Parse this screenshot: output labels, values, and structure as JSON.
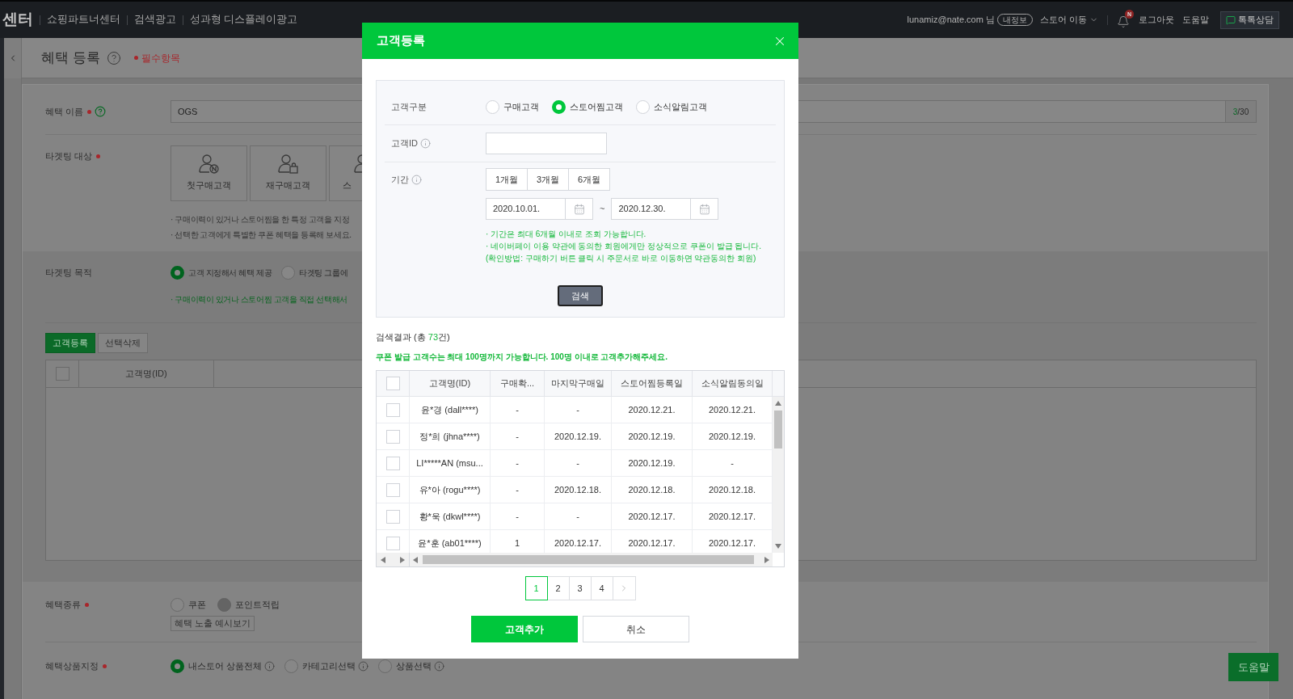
{
  "top_bar": {
    "logo": "센터",
    "menu": [
      "쇼핑파트너센터",
      "검색광고",
      "성과형 디스플레이광고"
    ],
    "user": "lunamiz@nate.com 님",
    "my_info_button": "내정보",
    "store_menu": "스토어 이동",
    "notification_badge": "N",
    "links": [
      "로그아웃",
      "도움말"
    ],
    "talk_button": "톡톡상담"
  },
  "page_header": {
    "title": "혜택 등록",
    "required_note": "필수항목"
  },
  "form": {
    "benefit_name": {
      "label": "혜택 이름",
      "required": true,
      "value": "OGS",
      "counter_current": "3",
      "counter_max": "/30"
    },
    "targeting_target": {
      "label": "타겟팅 대상",
      "required": true,
      "tiles": [
        {
          "label": "첫구매고객",
          "kind": "first_purchase",
          "cut_off": false
        },
        {
          "label": "재구매고객",
          "kind": "repeat_purchase",
          "cut_off": false
        },
        {
          "label": "스",
          "kind": "store_favorite",
          "cut_off": true
        }
      ],
      "notes": [
        "· 구매이력이 있거나 스토어찜을 한 특정 고객을 지정",
        "· 선택한 고객에게 특별한 쿠폰 혜택을 등록해 보세요."
      ]
    },
    "targeting_purpose": {
      "label": "타겟팅 목적",
      "required": false,
      "options": [
        {
          "label": "고객 지정해서 혜택 제공",
          "selected": true
        },
        {
          "label": "타겟팅 그룹에",
          "selected": false
        }
      ],
      "note": "· 구매이력이 있거나 스토어찜 고객을 직접 선택해서"
    },
    "customer_buttons": [
      {
        "label": "고객등록",
        "kind": "primary"
      },
      {
        "label": "선택삭제",
        "kind": "default"
      }
    ],
    "customer_table": {
      "select_all_checked": false,
      "columns": [
        "고객명(ID)"
      ]
    },
    "benefit_type": {
      "label": "혜택종류",
      "required": true,
      "options": [
        {
          "label": "쿠폰",
          "selected": false,
          "disabled": false
        },
        {
          "label": "포인트적립",
          "selected": false,
          "disabled": true
        }
      ],
      "preview_button": "혜택 노출 예시보기"
    },
    "product_scope": {
      "label": "혜택상품지정",
      "required": true,
      "options": [
        {
          "label": "내스토어 상품전체",
          "selected": true
        },
        {
          "label": "카테고리선택",
          "selected": false
        },
        {
          "label": "상품선택",
          "selected": false
        }
      ]
    }
  },
  "help_button": "도움말",
  "modal": {
    "title": "고객등록",
    "customer_type": {
      "label": "고객구분",
      "info": false,
      "options": [
        {
          "label": "구매고객",
          "selected": false
        },
        {
          "label": "스토어찜고객",
          "selected": true
        },
        {
          "label": "소식알림고객",
          "selected": false
        }
      ]
    },
    "customer_id": {
      "label": "고객ID",
      "info": true
    },
    "period": {
      "label": "기간",
      "info": true,
      "presets": [
        {
          "label": "1개월",
          "selected": false
        },
        {
          "label": "3개월",
          "selected": false
        },
        {
          "label": "6개월",
          "selected": false
        }
      ],
      "start_date": "2020.10.01.",
      "separator": "~",
      "end_date": "2020.12.30.",
      "notes": [
        "· 기간은 최대 6개월 이내로 조회 가능합니다.",
        "· 네이버페이 이용 약관에 동의한 회원에게만 정상적으로 쿠폰이 발급 됩니다.",
        "(확인방법: 구매하기 버튼 클릭 시 주문서로 바로 이동하면 약관동의한 회원)"
      ]
    },
    "search_button": "검색",
    "result_summary": {
      "label": "검색결과 (총",
      "count": "73",
      "unit": "건)"
    },
    "limit_notice": "쿠폰 발급 고객수는 최대 100명까지 가능합니다. 100명 이내로 고객추가해주세요.",
    "table": {
      "select_all_checked": false,
      "columns": [
        "고객명(ID)",
        "구매확...",
        "마지막구매일",
        "스토어찜등록일",
        "소식알림동의일"
      ],
      "rows": [
        {
          "checked": false,
          "cells": [
            "윤*경 (dall****)",
            "-",
            "-",
            "2020.12.21.",
            "2020.12.21."
          ]
        },
        {
          "checked": false,
          "cells": [
            "정*희 (jhna****)",
            "-",
            "2020.12.19.",
            "2020.12.19.",
            "2020.12.19."
          ]
        },
        {
          "checked": false,
          "cells": [
            "LI*****AN (msu...",
            "-",
            "-",
            "2020.12.19.",
            "-"
          ]
        },
        {
          "checked": false,
          "cells": [
            "유*아 (rogu****)",
            "-",
            "2020.12.18.",
            "2020.12.18.",
            "2020.12.18."
          ]
        },
        {
          "checked": false,
          "cells": [
            "황*욱 (dkwl****)",
            "-",
            "-",
            "2020.12.17.",
            "2020.12.17."
          ]
        },
        {
          "checked": false,
          "cells": [
            "윤*훈 (ab01****)",
            "1",
            "2020.12.17.",
            "2020.12.17.",
            "2020.12.17."
          ]
        }
      ]
    },
    "pagination": [
      {
        "label": "1",
        "selected": true
      },
      {
        "label": "2",
        "selected": false
      },
      {
        "label": "3",
        "selected": false
      },
      {
        "label": "4",
        "selected": false
      }
    ],
    "buttons": [
      {
        "label": "고객추가",
        "kind": "primary"
      },
      {
        "label": "취소",
        "kind": "default"
      }
    ]
  }
}
